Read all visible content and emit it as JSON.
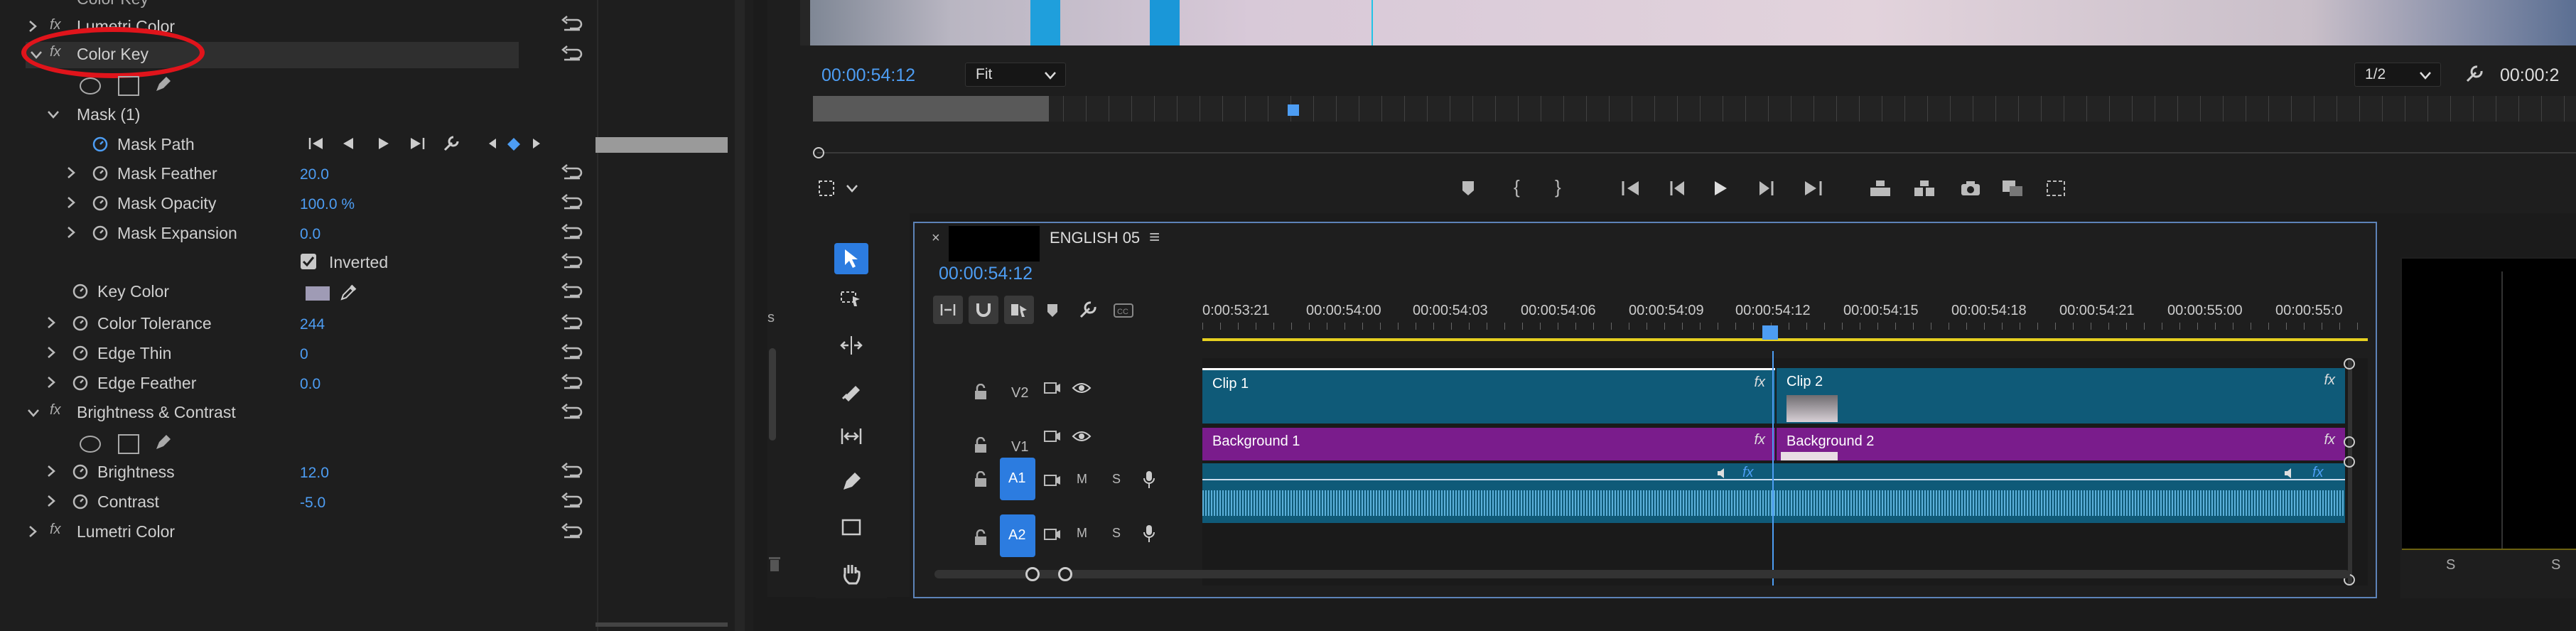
{
  "effect_controls": {
    "rows": [
      {
        "label": "Color Key",
        "type": "effect"
      },
      {
        "label": "Mask (1)",
        "type": "mask"
      },
      {
        "label": "Mask Path",
        "type": "param"
      },
      {
        "label": "Mask Feather",
        "value": "20.0"
      },
      {
        "label": "Mask Opacity",
        "value": "100.0 %"
      },
      {
        "label": "Mask Expansion",
        "value": "0.0"
      },
      {
        "label": "Inverted",
        "type": "checkbox"
      },
      {
        "label": "Key Color"
      },
      {
        "label": "Color Tolerance",
        "value": "244"
      },
      {
        "label": "Edge Thin",
        "value": "0"
      },
      {
        "label": "Edge Feather",
        "value": "0.0"
      },
      {
        "label": "Brightness & Contrast",
        "type": "effect"
      },
      {
        "label": "Brightness",
        "value": "12.0"
      },
      {
        "label": "Contrast",
        "value": "-5.0"
      },
      {
        "label": "Lumetri Color",
        "type": "effect"
      }
    ],
    "top_partial_labels": [
      "Lumetri Color",
      "Color Key"
    ],
    "key_color": "#9f9bb5",
    "annotation_color": "#e0141b"
  },
  "program": {
    "timecode": "00:00:54:12",
    "zoom": "Fit",
    "resolution": "1/2",
    "right_timecode": "00:00:2",
    "playhead_fraction": 0.2
  },
  "timeline": {
    "sequence_name": "ENGLISH 05",
    "timecode": "00:00:54:12",
    "ruler": [
      "0:00:53:21",
      "00:00:54:00",
      "00:00:54:03",
      "00:00:54:06",
      "00:00:54:09",
      "00:00:54:12",
      "00:00:54:15",
      "00:00:54:18",
      "00:00:54:21",
      "00:00:55:00",
      "00:00:55:0"
    ],
    "tracks": {
      "v2": "V2",
      "v1": "V1",
      "a1": "A1",
      "a2": "A2",
      "m": "M",
      "s": "S"
    },
    "clips": {
      "clip1": "Clip 1",
      "clip2": "Clip 2",
      "bg1": "Background 1",
      "bg2": "Background 2",
      "fx": "fx"
    },
    "colors": {
      "video": "#0f5a78",
      "bg": "#7a1c8c",
      "audio": "#0f5a78",
      "accent": "#2c7ce0"
    }
  },
  "right_panel": {
    "label_s": "S"
  }
}
